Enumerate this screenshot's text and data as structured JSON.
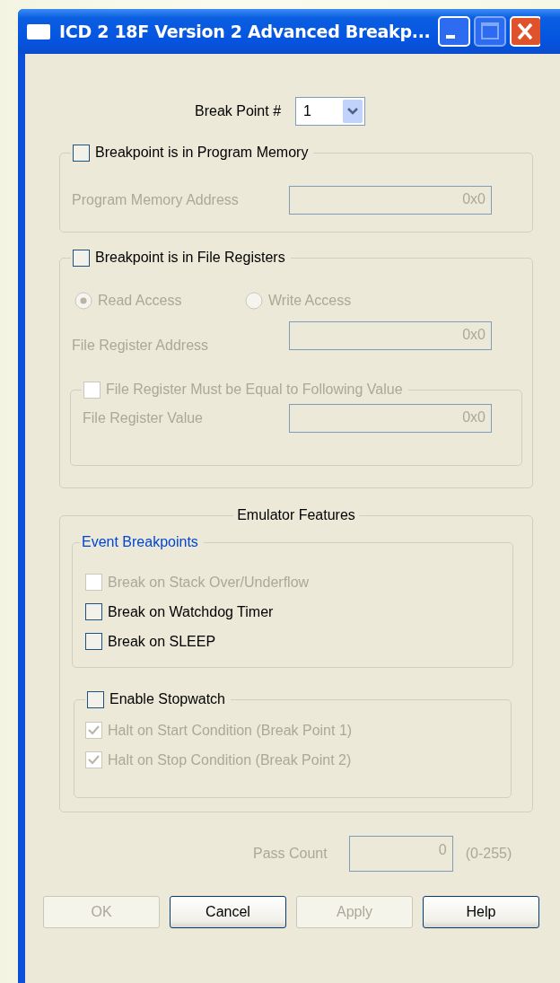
{
  "window": {
    "title": "ICD 2 18F Version 2 Advanced Breakp..."
  },
  "break_point": {
    "label": "Break Point #",
    "value": "1"
  },
  "program_memory": {
    "label": "Breakpoint is in Program Memory",
    "checked": false,
    "address_label": "Program Memory Address",
    "address": "0x0",
    "disabled": true
  },
  "file_registers": {
    "label": "Breakpoint is in File Registers",
    "checked": false,
    "disabled": true,
    "access": [
      {
        "label": "Read Access",
        "selected": true
      },
      {
        "label": "Write Access",
        "selected": false
      }
    ],
    "address_label": "File Register Address",
    "address": "0x0",
    "equal": {
      "label": "File Register Must be Equal to Following Value",
      "checked": false,
      "value_label": "File Register Value",
      "value": "0x0"
    }
  },
  "emulator": {
    "title": "Emulator Features",
    "event_title": "Event Breakpoints",
    "events": [
      {
        "label": "Break on Stack Over/Underflow",
        "checked": false,
        "disabled": true
      },
      {
        "label": "Break on Watchdog Timer",
        "checked": false,
        "disabled": false
      },
      {
        "label": "Break on SLEEP",
        "checked": false,
        "disabled": false
      }
    ],
    "stopwatch": {
      "label": "Enable Stopwatch",
      "checked": false,
      "disabled": true,
      "items": [
        {
          "label": "Halt on Start Condition (Break Point 1)",
          "checked": true
        },
        {
          "label": "Halt on Stop Condition (Break Point 2)",
          "checked": true
        }
      ]
    }
  },
  "pass_count": {
    "label": "Pass Count",
    "value": "0",
    "range": "(0-255)",
    "disabled": true
  },
  "buttons": [
    {
      "label": "OK",
      "disabled": true
    },
    {
      "label": "Cancel",
      "disabled": false
    },
    {
      "label": "Apply",
      "disabled": true
    },
    {
      "label": "Help",
      "disabled": false
    }
  ]
}
